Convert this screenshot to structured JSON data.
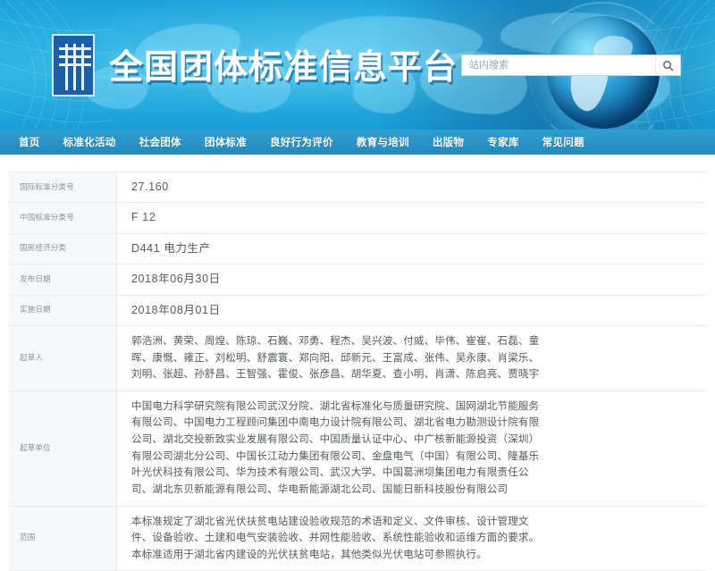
{
  "header": {
    "site_title": "全国团体标准信息平台",
    "logo_name": "national-standards-logo",
    "search": {
      "placeholder": "站内搜索",
      "value": "",
      "button_icon": "search-icon"
    }
  },
  "nav": {
    "items": [
      {
        "label": "首页",
        "name": "home"
      },
      {
        "label": "标准化活动",
        "name": "standardization-activities"
      },
      {
        "label": "社会团体",
        "name": "social-organizations"
      },
      {
        "label": "团体标准",
        "name": "group-standards"
      },
      {
        "label": "良好行为评价",
        "name": "good-behavior-evaluation"
      },
      {
        "label": "教育与培训",
        "name": "education-training"
      },
      {
        "label": "出版物",
        "name": "publications"
      },
      {
        "label": "专家库",
        "name": "expert-database"
      },
      {
        "label": "常见问题",
        "name": "faq"
      }
    ]
  },
  "detail": {
    "rows": [
      {
        "label": "国际标准分类号",
        "name": "ics-code",
        "value": "27.160"
      },
      {
        "label": "中国标准分类号",
        "name": "ccs-code",
        "value": "F 12"
      },
      {
        "label": "国民经济分类",
        "name": "economy-classification",
        "value": "D441 电力生产"
      },
      {
        "label": "发布日期",
        "name": "publish-date",
        "value": "2018年06月30日"
      },
      {
        "label": "实施日期",
        "name": "effective-date",
        "value": "2018年08月01日"
      }
    ],
    "drafters": {
      "label": "起草人",
      "lines": [
        "郭浩洲、黄荣、周煌、陈琼、石巍、邓勇、程杰、吴兴波、付威、毕伟、崔崔、石磊、童",
        "晖、康慨、雍正、刘松明、舒震寰、郑向阳、邱新元、王富成、张伟、吴永康、肖梁乐、",
        "刘明、张超、孙舒昌、王智强、霍俊、张彦昌、胡华夏、查小明、肖潇、陈启亮、贾晓宇"
      ]
    },
    "drafting_units": {
      "label": "起草单位",
      "lines": [
        "中国电力科学研究院有限公司武汉分院、湖北省标准化与质量研究院、国网湖北节能服务",
        "有限公司、中国电力工程顾问集团中南电力设计院有限公司、湖北省电力勘测设计院有限",
        "公司、湖北交投新致实业发展有限公司、中国质量认证中心、中广核新能源投资（深圳）",
        "有限公司湖北分公司、中国长江动力集团有限公司、金盘电气（中国）有限公司、隆基乐",
        "叶光伏科技有限公司、华为技术有限公司、武汉大学、中国葛洲坝集团电力有限责任公",
        "司、湖北东贝新能源有限公司、华电新能源湖北公司、国能日新科技股份有限公司"
      ]
    },
    "scope": {
      "label": "范围",
      "lines": [
        "本标准规定了湖北省光伏扶贫电站建设验收规范的术语和定义、文件审核、设计管理文",
        "件、设备验收、土建和电气安装验收、并网性能验收、系统性能验收和运维方面的要求。",
        "本标准适用于湖北省内建设的光伏扶贫电站，其他类似光伏电站可参照执行。"
      ]
    }
  },
  "colors": {
    "banner_primary": "#2cb1e2",
    "nav_bar": "#2b94c6",
    "label_text": "#8a9199",
    "value_text": "#555b61",
    "label_bg": "#f7f8fa",
    "border": "#e8eaec"
  }
}
